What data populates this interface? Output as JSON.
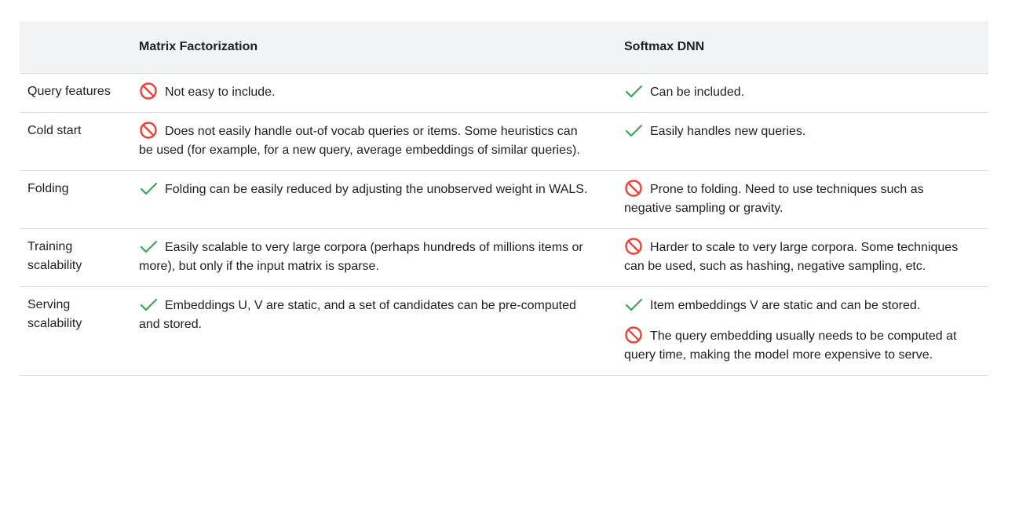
{
  "header": {
    "col1": "",
    "col2": "Matrix Factorization",
    "col3": "Softmax DNN"
  },
  "icons": {
    "check": "check-icon",
    "prohibited": "prohibited-icon",
    "check_color": "#34a853",
    "prohibited_color": "#ea4335"
  },
  "rows": [
    {
      "label": "Query features",
      "mf": [
        {
          "icon": "prohibited",
          "text": "Not easy to include."
        }
      ],
      "dnn": [
        {
          "icon": "check",
          "text": "Can be included."
        }
      ]
    },
    {
      "label": "Cold start",
      "mf": [
        {
          "icon": "prohibited",
          "text": "Does not easily handle out-of vocab queries or items. Some heuristics can be used (for example, for a new query, average embeddings of similar queries)."
        }
      ],
      "dnn": [
        {
          "icon": "check",
          "text": "Easily handles new queries."
        }
      ]
    },
    {
      "label": "Folding",
      "mf": [
        {
          "icon": "check",
          "text": "Folding can be easily reduced by adjusting the unobserved weight in WALS."
        }
      ],
      "dnn": [
        {
          "icon": "prohibited",
          "text": "Prone to folding. Need to use techniques such as negative sampling or gravity."
        }
      ]
    },
    {
      "label": "Training scalability",
      "mf": [
        {
          "icon": "check",
          "text": "Easily scalable to very large corpora (perhaps hundreds of millions items or more), but only if the input matrix is sparse."
        }
      ],
      "dnn": [
        {
          "icon": "prohibited",
          "text": "Harder to scale to very large corpora. Some techniques can be used, such as hashing, negative sampling, etc."
        }
      ]
    },
    {
      "label": "Serving scalability",
      "mf": [
        {
          "icon": "check",
          "text": "Embeddings U, V are static, and a set of candidates can be pre-computed and stored."
        }
      ],
      "dnn": [
        {
          "icon": "check",
          "text": "Item embeddings V are static and can be stored."
        },
        {
          "icon": "prohibited",
          "text": "The query embedding usually needs to be computed at query time, making the model more expensive to serve."
        }
      ]
    }
  ]
}
